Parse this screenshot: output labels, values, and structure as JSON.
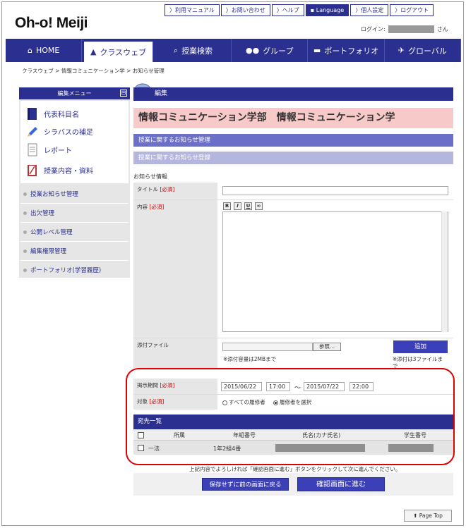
{
  "header": {
    "logo": "Oh-o! Meiji",
    "top_links": [
      "〉利用マニュアル",
      "〉お問い合わせ",
      "〉ヘルプ",
      "▪ Language",
      "〉個人設定",
      "〉ログアウト"
    ],
    "login_label": "ログイン:",
    "login_suffix": "さん"
  },
  "nav": {
    "items": [
      "HOME",
      "クラスウェブ",
      "授業検索",
      "グループ",
      "ポートフォリオ",
      "グローバル"
    ],
    "active": "クラスウェブ"
  },
  "breadcrumb": [
    "クラスウェブ",
    "情報コミュニケーション学",
    "お知らせ管理"
  ],
  "breadcrumb_sep": " > ",
  "sidebar": {
    "title": "編集メニュー",
    "collapse_glyph": "⊟",
    "main_items": [
      "代表科目名",
      "シラバスの補足",
      "レポート",
      "授業内容・資料"
    ],
    "links": [
      "授業お知らせ管理",
      "出欠管理",
      "公開レベル管理",
      "編集権限管理",
      "ポートフォリオ(学習履歴)"
    ]
  },
  "main": {
    "edit_title": "編集",
    "course_title": "情報コミュニケーション学部　情報コミュニケーション学",
    "bar_manage": "授業に関するお知らせ管理",
    "bar_register": "授業に関するお知らせ登録",
    "section_title": "お知らせ情報",
    "required": "[必須]",
    "title_label": "タイトル",
    "content_label": "内容",
    "editor_buttons": [
      "B",
      "I",
      "U",
      "∞"
    ],
    "attach_label": "添付ファイル",
    "browse_button": "参照...",
    "add_button": "追加",
    "attach_note": "※添付容量は2MBまで",
    "attach_limit_note_1": "※添付は3ファイルま",
    "attach_limit_note_2": "で",
    "period_label": "掲示期間",
    "start_date": "2015/06/22",
    "start_time": "17:00",
    "period_sep": "～",
    "end_date": "2015/07/22",
    "end_time": "22:00",
    "target_label": "対象",
    "target_options": [
      "すべての履修者",
      "履修者を選択"
    ],
    "target_selected": 1
  },
  "recipients": {
    "title": "宛先一覧",
    "columns": [
      "所属",
      "年組番号",
      "氏名(カナ氏名)",
      "学生番号"
    ],
    "rows": [
      {
        "affiliation": "一法",
        "class_no": "1年2組4番"
      }
    ]
  },
  "confirm_text": "上記内容でよろしければ「確認画面に進む」ボタンをクリックして次に進んでください。",
  "back_button": "保存せずに前の画面に戻る",
  "confirm_button": "確認画面に進む",
  "page_top": "Page Top",
  "colors": {
    "navy": "#2b2f8f",
    "pink": "#f8c9c9",
    "highlight": "#e00000"
  }
}
